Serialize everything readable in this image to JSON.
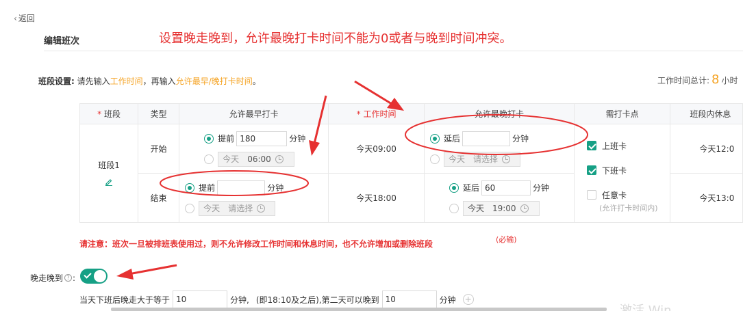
{
  "back_label": "返回",
  "page_title": "编辑班次",
  "banner": "设置晚走晚到，允许最晚打卡时间不能为0或者与晚到时间冲突。",
  "section": {
    "label": "班段设置:",
    "hint_1": "请先输入",
    "hint_work": "工作时间",
    "hint_2": "，再输入",
    "hint_allow": "允许最早/晚打卡时间",
    "hint_3": "。"
  },
  "total": {
    "label": "工作时间总计:",
    "value": "8",
    "unit": "小时"
  },
  "table": {
    "headers": [
      "班段",
      "类型",
      "允许最早打卡",
      "工作时间",
      "允许最晚打卡",
      "需打卡点",
      "班段内休息"
    ],
    "required_mark": "*",
    "segment_name": "班段1",
    "rows": [
      {
        "type": "开始",
        "early_opt1_label": "提前",
        "early_opt1_value": "180",
        "early_unit": "分钟",
        "early_opt2_day": "今天",
        "early_opt2_time": "06:00",
        "work_time": "今天09:00",
        "late_opt1_label": "延后",
        "late_opt1_value": "",
        "late_unit": "分钟",
        "late_opt2_day": "今天",
        "late_opt2_time": "请选择",
        "rest": "今天12:0"
      },
      {
        "type": "结束",
        "early_opt1_label": "提前",
        "early_opt1_value": "",
        "early_unit": "分钟",
        "early_opt2_day": "今天",
        "early_opt2_time": "请选择",
        "work_time": "今天18:00",
        "late_opt1_label": "延后",
        "late_opt1_value": "60",
        "late_unit": "分钟",
        "late_opt2_day": "今天",
        "late_opt2_time": "19:00",
        "rest": "今天13:0"
      }
    ],
    "checkpoints": [
      {
        "label": "上班卡",
        "checked": true
      },
      {
        "label": "下班卡",
        "checked": true
      },
      {
        "label": "任意卡",
        "checked": false,
        "note": "(允许打卡时间内)"
      }
    ]
  },
  "warning": "请注意：班次一旦被排班表使用过，则不允许修改工作时间和休息时间，也不允许增加或删除班段",
  "must_note": "(必输)",
  "late_leave": {
    "label": "晚走晚到",
    "help": "?",
    "colon": ":",
    "enabled": true,
    "rule_1": "当天下班后晚走大于等于",
    "value_1": "10",
    "unit_1": "分钟,",
    "rule_2": "(即18:10及之后)",
    "rule_3": ",第二天可以晚到",
    "value_2": "10",
    "unit_2": "分钟",
    "add": "+"
  },
  "watermark": "激活 Win",
  "colors": {
    "accent": "#16a085",
    "warning": "#e63131",
    "highlight": "#f5a323"
  }
}
